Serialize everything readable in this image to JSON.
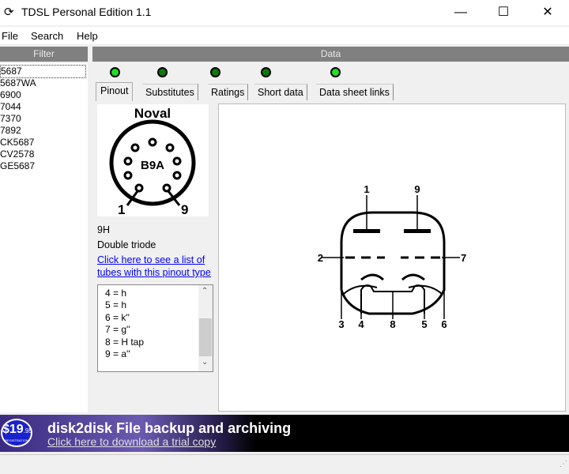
{
  "window": {
    "title": "TDSL Personal Edition 1.1",
    "minimize": "—",
    "maximize": "☐",
    "close": "✕"
  },
  "menu": [
    "File",
    "Search",
    "Help"
  ],
  "filter": {
    "header": "Filter",
    "items": [
      "5687",
      "5687WA",
      "6900",
      "7044",
      "7370",
      "7892",
      "CK5687",
      "CV2578",
      "GE5687"
    ],
    "selected": 0
  },
  "data": {
    "header": "Data",
    "leds": [
      {
        "state": "on",
        "color": "#22dd22"
      },
      {
        "state": "off",
        "color": "#0a7a0a"
      },
      {
        "state": "off",
        "color": "#0a7a0a"
      },
      {
        "state": "off",
        "color": "#0a7a0a"
      },
      {
        "state": "on",
        "color": "#22dd22"
      }
    ],
    "tabs": [
      "Pinout",
      "Substitutes",
      "Ratings",
      "Short data",
      "Data sheet links"
    ],
    "active_tab": "Pinout"
  },
  "pinout": {
    "base_name": "Noval",
    "base_code": "B9A",
    "base_pins": [
      "1",
      "9"
    ],
    "code": "9H",
    "type": "Double triode",
    "link_line1": "Click here to see a list of",
    "link_line2": "tubes with this pinout type",
    "pins": [
      "4 = h",
      "5 = h",
      "6 = k''",
      "7 = g''",
      "8 = H tap",
      "9 = a''"
    ],
    "diagram_labels": {
      "p1": "1",
      "p9": "9",
      "p2": "2",
      "p7": "7",
      "p3": "3",
      "p4": "4",
      "p8": "8",
      "p5": "5",
      "p6": "6"
    }
  },
  "banner": {
    "price_main": "$19",
    "price_cents": ".95",
    "price_sub": "REGISTRATION",
    "headline": "disk2disk File backup and archiving",
    "link": "Click here to download a trial copy"
  }
}
